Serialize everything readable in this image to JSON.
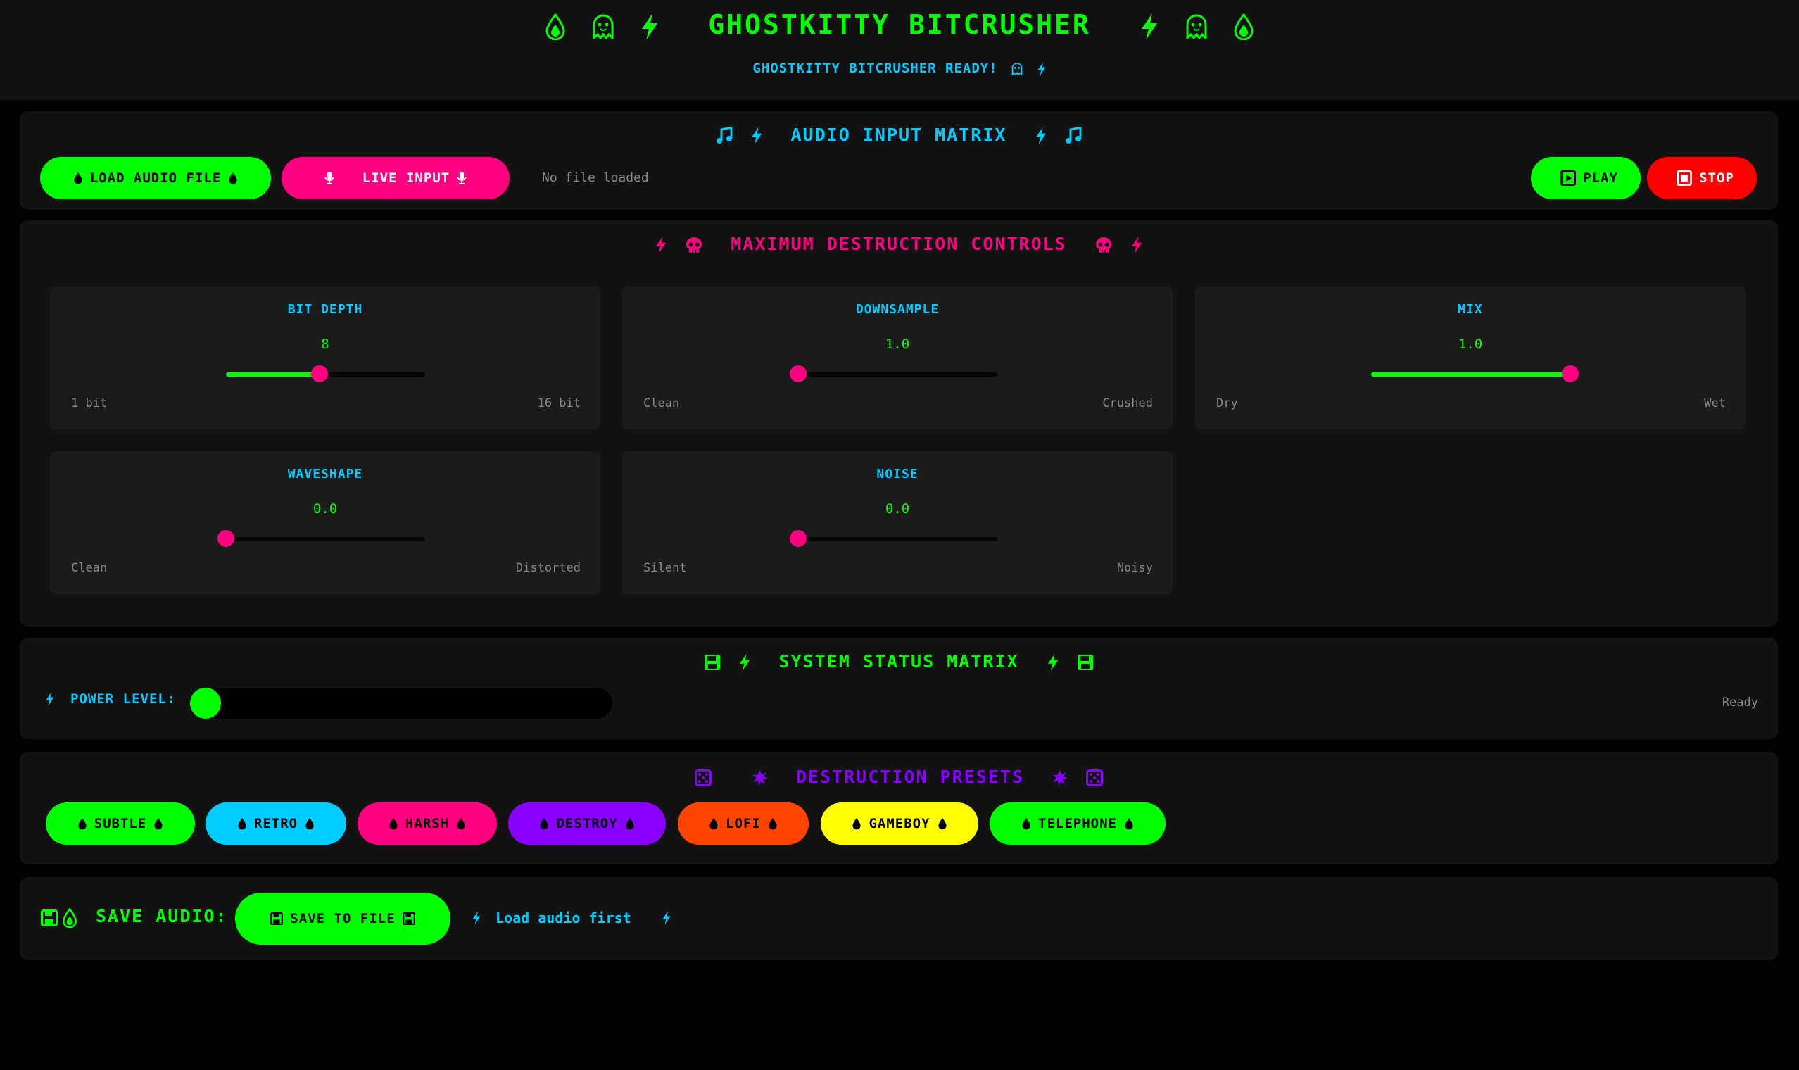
{
  "app": {
    "title": "GHOSTKITTY BITCRUSHER",
    "status": "GHOSTKITTY BITCRUSHER READY!"
  },
  "input_panel": {
    "title": "AUDIO INPUT MATRIX",
    "load_label": "LOAD AUDIO FILE",
    "live_label": "LIVE INPUT",
    "file_status": "No file loaded",
    "play_label": "PLAY",
    "stop_label": "STOP"
  },
  "controls_panel": {
    "title": "MAXIMUM DESTRUCTION CONTROLS",
    "controls": [
      {
        "label": "BIT DEPTH",
        "value": "8",
        "min_label": "1 bit",
        "max_label": "16 bit",
        "fraction": 0.47,
        "filled": true
      },
      {
        "label": "DOWNSAMPLE",
        "value": "1.0",
        "min_label": "Clean",
        "max_label": "Crushed",
        "fraction": 0.0,
        "filled": false
      },
      {
        "label": "MIX",
        "value": "1.0",
        "min_label": "Dry",
        "max_label": "Wet",
        "fraction": 1.0,
        "filled": true
      },
      {
        "label": "WAVESHAPE",
        "value": "0.0",
        "min_label": "Clean",
        "max_label": "Distorted",
        "fraction": 0.0,
        "filled": false
      },
      {
        "label": "NOISE",
        "value": "0.0",
        "min_label": "Silent",
        "max_label": "Noisy",
        "fraction": 0.0,
        "filled": false
      }
    ]
  },
  "status_panel": {
    "title": "SYSTEM STATUS MATRIX",
    "power_label": "POWER LEVEL:",
    "power_level": 0.0,
    "status_text": "Ready"
  },
  "presets_panel": {
    "title": "DESTRUCTION PRESETS",
    "presets": [
      {
        "label": "SUBTLE",
        "color": "#00ff00"
      },
      {
        "label": "RETRO",
        "color": "#00ccff"
      },
      {
        "label": "HARSH",
        "color": "#ff0080"
      },
      {
        "label": "DESTROY",
        "color": "#8800ff"
      },
      {
        "label": "LOFI",
        "color": "#ff4400"
      },
      {
        "label": "GAMEBOY",
        "color": "#ffff00"
      },
      {
        "label": "TELEPHONE",
        "color": "#00ff00"
      }
    ]
  },
  "save_panel": {
    "title": "SAVE AUDIO:",
    "save_label": "SAVE TO FILE",
    "hint": "Load audio first"
  },
  "colors": {
    "green": "#00ff00",
    "cyan": "#00ccff",
    "pink": "#ff0080",
    "purple": "#8800ff",
    "red": "#ff0000"
  },
  "icons": [
    "droplet-icon",
    "ghost-icon",
    "bolt-icon",
    "music-note-icon",
    "microphone-icon",
    "play-icon",
    "stop-icon",
    "skull-icon",
    "floppy-disk-icon",
    "dice-icon",
    "burst-icon"
  ]
}
